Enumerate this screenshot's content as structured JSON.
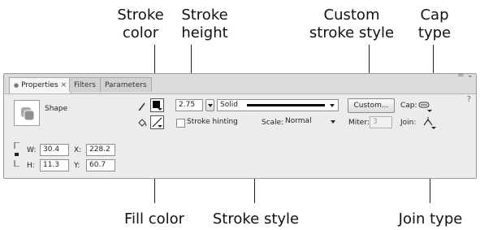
{
  "callouts": {
    "stroke_color": [
      "Stroke",
      "color"
    ],
    "stroke_height": [
      "Stroke",
      "height"
    ],
    "custom_stroke_style": [
      "Custom",
      "stroke style"
    ],
    "cap_type": [
      "Cap",
      "type"
    ],
    "fill_color": "Fill color",
    "stroke_style": "Stroke style",
    "join_type": "Join type"
  },
  "tabs": [
    {
      "label": "Properties",
      "active": true
    },
    {
      "label": "Filters",
      "active": false
    },
    {
      "label": "Parameters",
      "active": false
    }
  ],
  "shape_label": "Shape",
  "dimensions": {
    "w_label": "W:",
    "w_value": "30.4",
    "h_label": "H:",
    "h_value": "11.3",
    "x_label": "X:",
    "x_value": "228.2",
    "y_label": "Y:",
    "y_value": "60.7"
  },
  "stroke": {
    "height_value": "2.75",
    "style_value": "Solid",
    "hinting_label": "Stroke hinting",
    "scale_label": "Scale:",
    "scale_value": "Normal",
    "custom_button": "Custom...",
    "miter_label": "Miter:",
    "miter_value": "3",
    "cap_label": "Cap:",
    "join_label": "Join:"
  },
  "colors": {
    "stroke_color": "#000000",
    "fill_color": "none"
  }
}
